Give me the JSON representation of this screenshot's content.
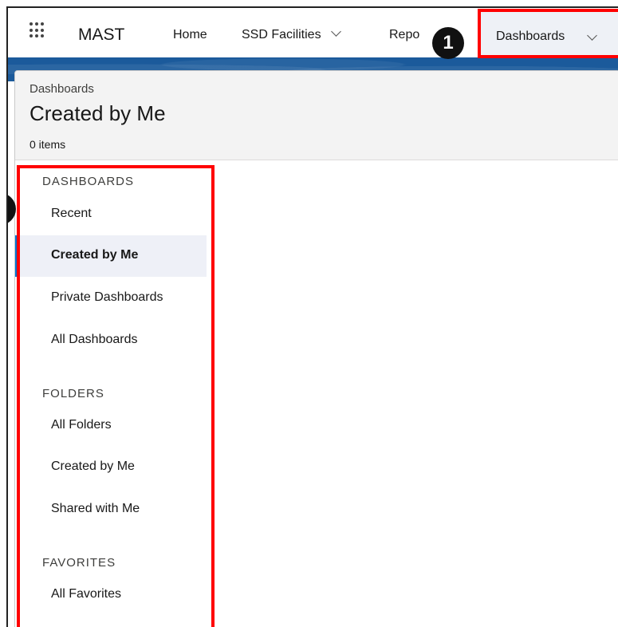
{
  "nav": {
    "app_name": "MAST",
    "items": [
      {
        "label": "Home"
      },
      {
        "label": "SSD Facilities"
      },
      {
        "label": "Repo"
      },
      {
        "label": "Dashboards"
      }
    ]
  },
  "annotations": {
    "badge_1": "1"
  },
  "header": {
    "breadcrumb": "Dashboards",
    "title": "Created by Me",
    "count": "0 items"
  },
  "sidebar": {
    "sections": [
      {
        "title": "DASHBOARDS",
        "items": [
          {
            "label": "Recent"
          },
          {
            "label": "Created by Me",
            "selected": true
          },
          {
            "label": "Private Dashboards"
          },
          {
            "label": "All Dashboards"
          }
        ]
      },
      {
        "title": "FOLDERS",
        "items": [
          {
            "label": "All Folders"
          },
          {
            "label": "Created by Me"
          },
          {
            "label": "Shared with Me"
          }
        ]
      },
      {
        "title": "FAVORITES",
        "items": [
          {
            "label": "All Favorites"
          }
        ]
      }
    ]
  },
  "colors": {
    "brand_blue": "#0176d3",
    "band_blue": "#1b5a9b",
    "highlight_red": "#ff0000",
    "selected_bg": "#eef0f7"
  }
}
